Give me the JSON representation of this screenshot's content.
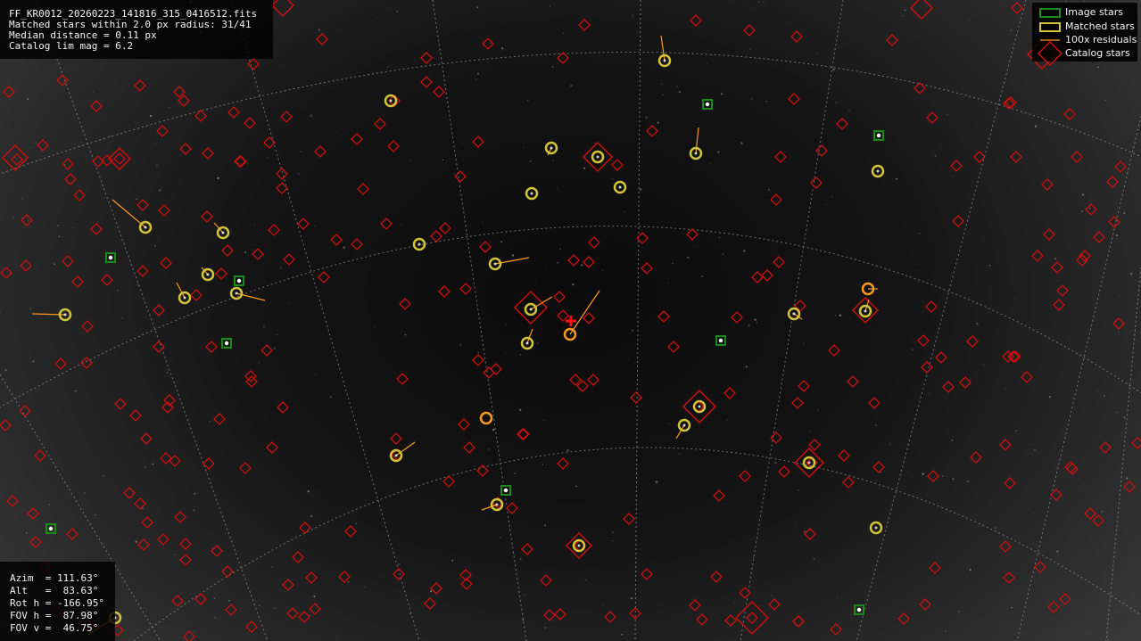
{
  "header": {
    "filename": "FF_KR0012_20260223_141816_315_0416512.fits",
    "matched_line": "Matched stars within 2.0 px radius: 31/41",
    "median_line": "Median distance = 0.11 px",
    "catalog_line": "Catalog lim mag = 6.2"
  },
  "pointing": {
    "azim": "Azim  = 111.63°",
    "alt": "Alt   =  83.63°",
    "rot": "Rot h = -166.95°",
    "fov_h": "FOV h =  87.98°",
    "fov_v": "FOV v =  46.75°"
  },
  "legend": {
    "image_stars": "Image stars",
    "matched_stars": "Matched stars",
    "residuals": "100x residuals",
    "catalog_stars": "Catalog stars"
  },
  "colors": {
    "image_star": "#1a8a1a",
    "matched_star": "#d2c43a",
    "residual": "#ff9a20",
    "catalog_star": "#cc1010",
    "grid": "#9a9a9a",
    "centre_marker": "#ff1010"
  }
}
